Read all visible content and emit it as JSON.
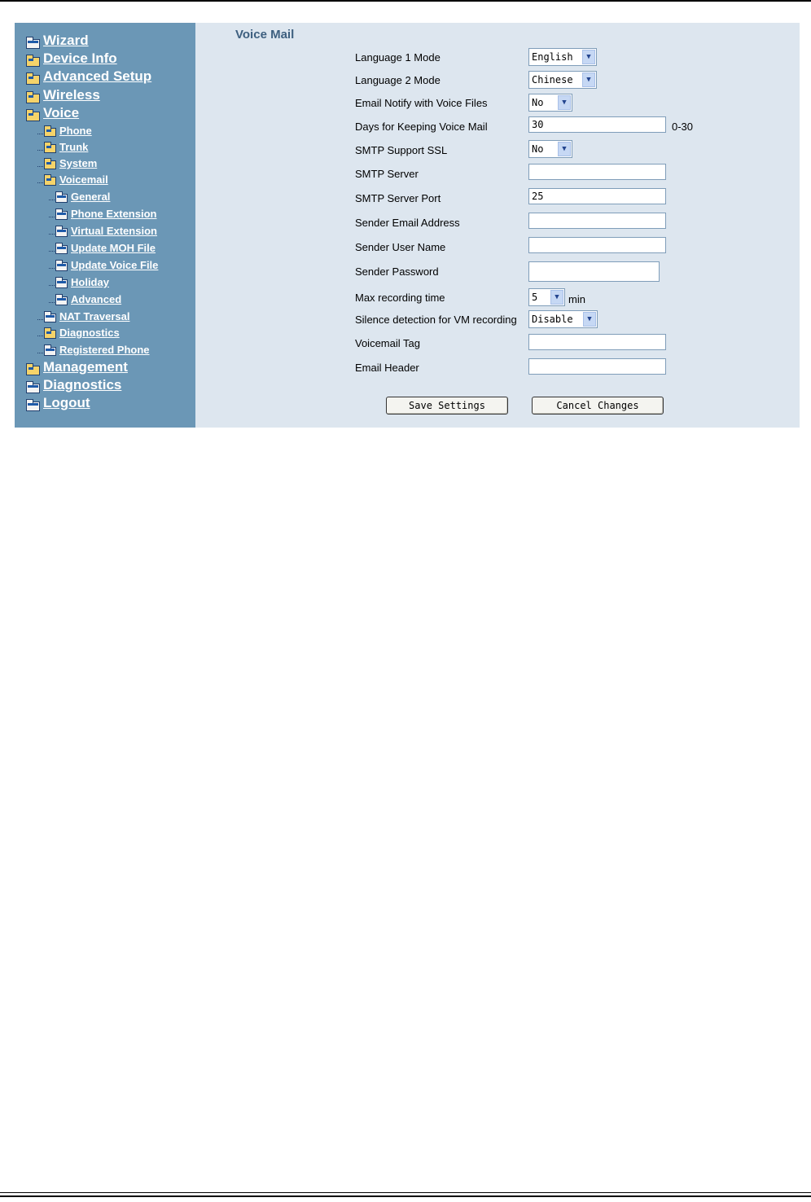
{
  "nav": {
    "wizard": "Wizard",
    "device_info": "Device Info",
    "advanced_setup": "Advanced Setup",
    "wireless": "Wireless",
    "voice": "Voice",
    "phone": "Phone",
    "trunk": "Trunk",
    "system": "System",
    "voicemail": "Voicemail",
    "general": "General",
    "phone_extension": "Phone Extension",
    "virtual_extension": "Virtual Extension",
    "update_moh_file": "Update MOH File",
    "update_voice_file": "Update Voice File",
    "holiday": "Holiday",
    "advanced": "Advanced",
    "nat_traversal": "NAT Traversal",
    "voice_diagnostics": "Diagnostics",
    "registered_phone": "Registered Phone",
    "management": "Management",
    "diagnostics": "Diagnostics",
    "logout": "Logout"
  },
  "page": {
    "title": "Voice Mail"
  },
  "form": {
    "language1": {
      "label": "Language 1 Mode",
      "value": "English"
    },
    "language2": {
      "label": "Language 2 Mode",
      "value": "Chinese"
    },
    "email_notify": {
      "label": "Email Notify with Voice Files",
      "value": "No"
    },
    "days_keep": {
      "label": "Days for Keeping Voice Mail",
      "value": "30",
      "range": "0-30"
    },
    "smtp_ssl": {
      "label": "SMTP Support SSL",
      "value": "No"
    },
    "smtp_server": {
      "label": "SMTP Server",
      "value": ""
    },
    "smtp_port": {
      "label": "SMTP Server Port",
      "value": "25"
    },
    "sender_email": {
      "label": "Sender Email Address",
      "value": ""
    },
    "sender_user": {
      "label": "Sender User Name",
      "value": ""
    },
    "sender_password": {
      "label": "Sender Password",
      "value": ""
    },
    "max_recording": {
      "label": "Max recording time",
      "value": "5",
      "unit": "min"
    },
    "silence_detection": {
      "label": "Silence detection for VM recording",
      "value": "Disable"
    },
    "voicemail_tag": {
      "label": "Voicemail Tag",
      "value": ""
    },
    "email_header": {
      "label": "Email Header",
      "value": ""
    }
  },
  "buttons": {
    "save": "Save Settings",
    "cancel": "Cancel Changes"
  },
  "icons": {
    "folder": "folder-icon",
    "open_folder": "open-folder-icon",
    "dropdown": "chevron-down-icon"
  },
  "colors": {
    "sidebar_bg": "#6b97b6",
    "content_bg": "#dde6ef",
    "title": "#3d5f7f"
  }
}
